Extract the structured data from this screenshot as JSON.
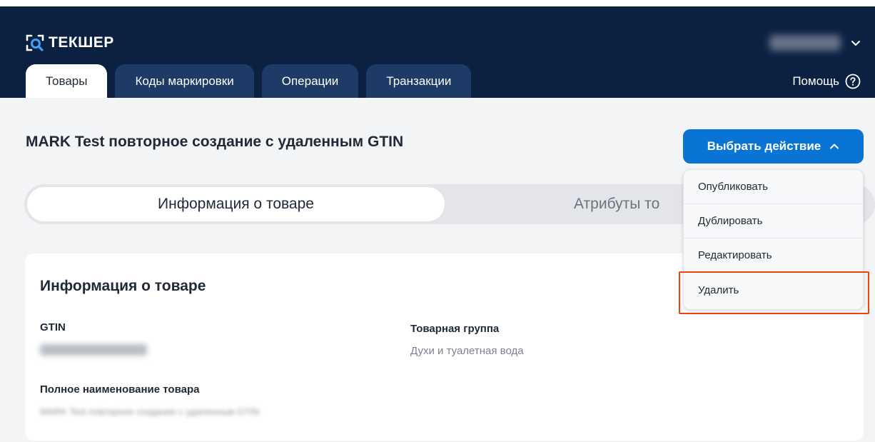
{
  "app": {
    "logo_text": "ТЕКШЕР",
    "accent_color": "#0a74d4",
    "header_color": "#0c2142",
    "highlight_color": "#f2420a"
  },
  "header": {
    "tabs": [
      {
        "label": "Товары",
        "active": true
      },
      {
        "label": "Коды маркировки",
        "active": false
      },
      {
        "label": "Операции",
        "active": false
      },
      {
        "label": "Транзакции",
        "active": false
      }
    ],
    "help_label": "Помощь",
    "help_icon": "question-circle-icon",
    "user_menu_icon": "chevron-down-icon"
  },
  "main": {
    "title": "MARK Test повторное создание с удаленным GTIN",
    "action_button_label": "Выбрать действие",
    "action_menu": [
      {
        "label": "Опубликовать"
      },
      {
        "label": "Дублировать"
      },
      {
        "label": "Редактировать"
      },
      {
        "label": "Удалить",
        "highlighted": true
      }
    ],
    "switcher": {
      "active_label": "Информация о товаре",
      "inactive_label": "Атрибуты то"
    }
  },
  "card": {
    "title": "Информация о товаре",
    "fields": {
      "gtin_label": "GTIN",
      "group_label": "Товарная группа",
      "group_value": "Духи и туалетная вода",
      "name_label": "Полное наименование товара",
      "name_value": "MARK Test повторное создание с удаленным GTIN"
    }
  }
}
